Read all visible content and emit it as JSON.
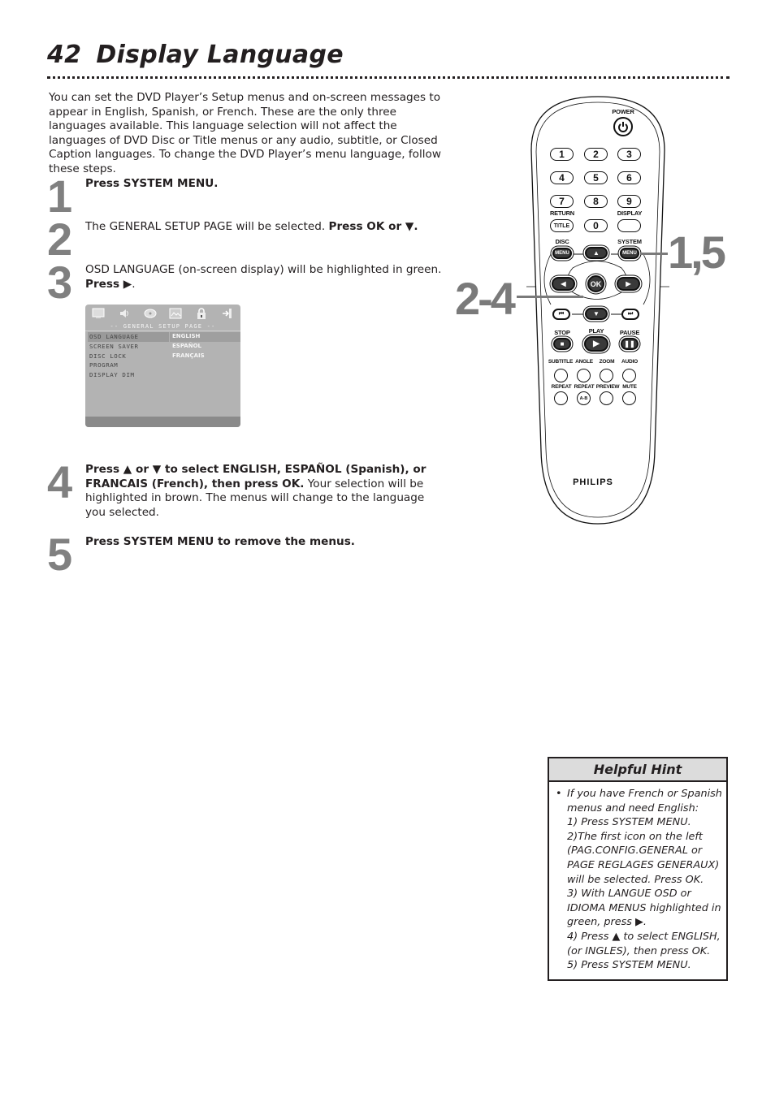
{
  "header": {
    "page_number": "42",
    "title": "Display Language"
  },
  "intro": "You can set the DVD Player’s Setup menus and on-screen messages to appear in English, Spanish, or French. These are the only three languages available. This language selection will not affect the languages of DVD Disc or Title menus or any audio, subtitle, or Closed Caption languages. To change the DVD Player’s menu language, follow these steps.",
  "steps": [
    {
      "number": "1",
      "bold_lead": "Press SYSTEM MENU.",
      "text": "",
      "bold_tail": ""
    },
    {
      "number": "2",
      "text": "The GENERAL SETUP PAGE will be selected. ",
      "bold_tail": "Press OK or ▼."
    },
    {
      "number": "3",
      "text": "OSD LANGUAGE (on-screen display) will be highlighted in green.",
      "bold_tail": "Press ▶",
      "tail": "."
    },
    {
      "number": "4",
      "bold_lead": "Press ▲ or ▼ to select ENGLISH, ESPAÑOL (Spanish), or FRANCAIS (French), then press OK.",
      "text": " Your selection will be highlighted in brown. The menus will change to the language you selected."
    },
    {
      "number": "5",
      "bold_lead": "Press SYSTEM MENU",
      "bold_tail": " to remove the menus."
    }
  ],
  "osd_screen": {
    "icons": [
      "tv-icon",
      "speaker-icon",
      "disc-icon",
      "picture-icon",
      "lock-icon",
      "exit-icon"
    ],
    "header": "-- GENERAL SETUP PAGE --",
    "menu_items": [
      "OSD LANGUAGE",
      "SCREEN SAVER",
      "DISC LOCK",
      "PROGRAM",
      "DISPLAY DIM"
    ],
    "selected_item": "OSD LANGUAGE",
    "options": [
      "ENGLISH",
      "ESPAÑOL",
      "FRANÇAIS"
    ],
    "selected_option": "ENGLISH"
  },
  "remote": {
    "brand": "PHILIPS",
    "power_label": "POWER",
    "digits": [
      "1",
      "2",
      "3",
      "4",
      "5",
      "6",
      "7",
      "8",
      "9",
      "0"
    ],
    "return_label": "RETURN",
    "display_label": "DISPLAY",
    "title_button": "TITLE",
    "disc_label": "DISC",
    "system_label": "SYSTEM",
    "menu_button": "MENU",
    "ok_button": "OK",
    "stop_label": "STOP",
    "play_label": "PLAY",
    "pause_label": "PAUSE",
    "row_labels_1": [
      "SUBTITLE",
      "ANGLE",
      "ZOOM",
      "AUDIO"
    ],
    "row_labels_2": [
      "REPEAT",
      "REPEAT",
      "PREVIEW",
      "MUTE"
    ],
    "ab_button": "A-B",
    "callout_system": "1,5",
    "callout_nav": "2-4"
  },
  "hint": {
    "title": "Helpful Hint",
    "bullet": "•",
    "lines": [
      "If you have French or Spanish",
      "menus and need English:",
      "1) Press SYSTEM MENU.",
      "2)The first icon on the left",
      "(PAG.CONFIG.GENERAL or",
      "PAGE REGLAGES GENERAUX)",
      "will be selected. Press OK.",
      "3) With LANGUE OSD or",
      "IDIOMA MENUS highlighted in",
      "green, press ▶.",
      "4) Press ▲ to select ENGLISH,",
      "(or INGLES), then press OK.",
      "5) Press SYSTEM MENU."
    ]
  }
}
